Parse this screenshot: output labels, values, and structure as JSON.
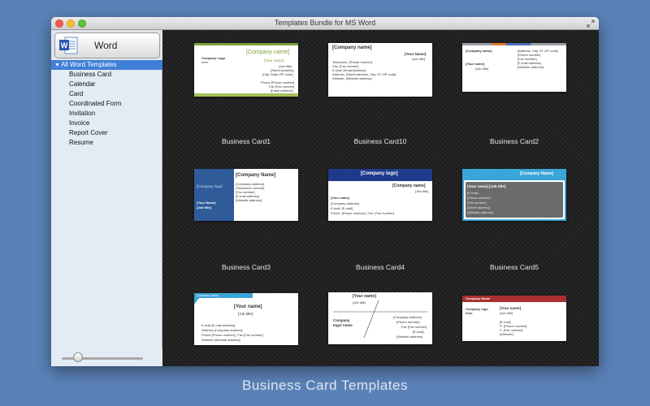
{
  "window": {
    "title": "Templates Bundle for MS Word"
  },
  "sidebar": {
    "word_button_label": "Word",
    "tree_root": "All Word Templates",
    "items": [
      "Business Card",
      "Calendar",
      "Card",
      "Coordinated Form",
      "Invitation",
      "Invoice",
      "Report Cover",
      "Resume"
    ],
    "zoom_slider_fraction": 0.2
  },
  "templates": [
    {
      "name": "Business Card1",
      "lines": [
        "Company Logo",
        "here",
        "[Company name]",
        "[Your name]",
        "[Job title]",
        "[Street Address]",
        "[City, State ZIP code]",
        "Phone [Phone number]",
        "Fax [Fax number]",
        "[Email address]"
      ]
    },
    {
      "name": "Business Card10",
      "lines": [
        "[Company name]",
        "[Your Name]",
        "[Job title]",
        "Telephone: [Phone number]",
        "Fax: [Fax number]",
        "E-mail: [Email Address]",
        "Address: [Street address, City, ST ZIP code]",
        "Website: [Website address]"
      ]
    },
    {
      "name": "Business Card2",
      "lines": [
        "[Company name]",
        "[Address, City, ST ZIP code]",
        "[Phone number]",
        "[Fax number]",
        "[E-mail address]",
        "[Website address]",
        "[Your name]",
        "[Job title]"
      ]
    },
    {
      "name": "Business Card3",
      "lines": [
        "[Company logo]",
        "[Company Name]",
        "[Company address]",
        "[Telephone number]",
        "[Fax number]",
        "[E-mail address]",
        "[Website address]",
        "[Your Name]",
        "[Job title]"
      ]
    },
    {
      "name": "Business Card4",
      "lines": [
        "[Company logo]",
        "[Company name]",
        "[Job title]",
        "[Your name]",
        "[Company address]",
        "E-mail: [E-mail]",
        "Phone: [Phone number] | Fax: [Fax number]"
      ]
    },
    {
      "name": "Business Card5",
      "lines": [
        "[Company Name]",
        "[Your name]  [Job title]",
        "[E-mail]",
        "[Phone number]",
        "[Fax number]",
        "[Street address]",
        "[Website address]"
      ]
    },
    {
      "name": "",
      "lines": [
        "[Company name]",
        "[Your name]",
        "[Job title]",
        "E-mail [E-mail address]",
        "Address [Company address]",
        "Phone [Phone number] | Fax [Fax number]",
        "Website [Website address]"
      ]
    },
    {
      "name": "",
      "lines": [
        "[Your name]",
        "[Job title]",
        "[Company address]",
        "[Phone number]",
        "Fax [Fax number]",
        "[E-mail]",
        "[Website address]",
        "Company",
        "logo/ name"
      ]
    },
    {
      "name": "",
      "lines": [
        "Company Name",
        "Company logo",
        "here",
        "[Your name]",
        "[Job title]",
        "[E-mail]",
        "P: [Phone number]",
        "F: [Fax number]",
        "[Website]"
      ]
    }
  ],
  "caption": "Business Card Templates",
  "colors": {
    "desktop": "#5b82b8",
    "sidebar_selection": "#3f7fd8",
    "word_blue": "#2b5aae"
  }
}
